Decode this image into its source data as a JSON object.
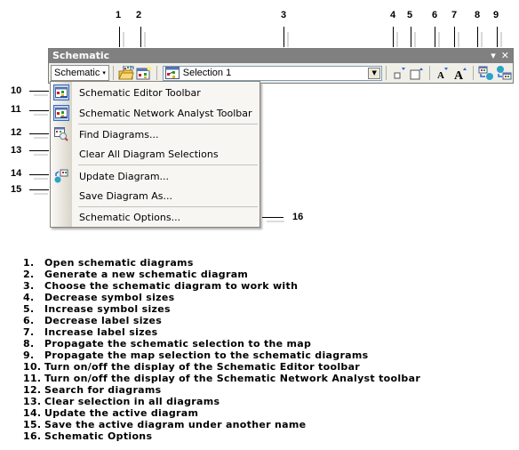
{
  "window": {
    "title": "Schematic",
    "title_buttons": {
      "dropdown": "▾",
      "close": "✕"
    }
  },
  "toolbar": {
    "menu_button_label": "Schematic",
    "menu_button_caret": "▾",
    "buttons": [
      {
        "id": 1,
        "name": "open-schematic-diagrams",
        "icon": "open-folder-diagram-icon"
      },
      {
        "id": 2,
        "name": "generate-new-schematic-diagram",
        "icon": "new-diagram-icon"
      },
      {
        "id": 4,
        "name": "decrease-symbol-sizes",
        "icon": "decrease-symbol-icon"
      },
      {
        "id": 5,
        "name": "increase-symbol-sizes",
        "icon": "increase-symbol-icon"
      },
      {
        "id": 6,
        "name": "decrease-label-sizes",
        "icon": "decrease-label-icon"
      },
      {
        "id": 7,
        "name": "increase-label-sizes",
        "icon": "increase-label-icon"
      },
      {
        "id": 8,
        "name": "propagate-schematic-to-map",
        "icon": "diagram-to-globe-icon"
      },
      {
        "id": 9,
        "name": "propagate-map-to-schematic",
        "icon": "globe-to-diagram-icon"
      }
    ],
    "diagram_combo": {
      "value": "Selection 1",
      "arrow": "▼"
    }
  },
  "menu": {
    "items": [
      {
        "label": "Schematic Editor Toolbar",
        "icon": "editor-toolbar-icon",
        "checked": true
      },
      {
        "label": "Schematic Network Analyst Toolbar",
        "icon": "network-analyst-toolbar-icon",
        "checked": true
      },
      {
        "label": "Find Diagrams...",
        "icon": "find-diagrams-icon",
        "checked": false
      },
      {
        "label": "Clear All Diagram Selections",
        "icon": "",
        "checked": false
      },
      {
        "label": "Update Diagram...",
        "icon": "update-diagram-icon",
        "checked": false
      },
      {
        "label": "Save Diagram As...",
        "icon": "",
        "checked": false
      },
      {
        "label": "Schematic Options...",
        "icon": "",
        "checked": false
      }
    ]
  },
  "callouts": {
    "top": [
      "1",
      "2",
      "3",
      "4",
      "5",
      "6",
      "7",
      "8",
      "9"
    ],
    "left": [
      "10",
      "11",
      "12",
      "13",
      "14",
      "15"
    ],
    "right": [
      "16"
    ]
  },
  "legend": [
    {
      "num": "1.",
      "text": "Open schematic diagrams"
    },
    {
      "num": "2.",
      "text": "Generate a new schematic diagram"
    },
    {
      "num": "3.",
      "text": "Choose the schematic diagram to work with"
    },
    {
      "num": "4.",
      "text": "Decrease symbol sizes"
    },
    {
      "num": "5.",
      "text": "Increase symbol sizes"
    },
    {
      "num": "6.",
      "text": "Decrease label sizes"
    },
    {
      "num": "7.",
      "text": "Increase label sizes"
    },
    {
      "num": "8.",
      "text": "Propagate the schematic selection to the map"
    },
    {
      "num": "9.",
      "text": "Propagate the map selection to the schematic diagrams"
    },
    {
      "num": "10.",
      "text": "Turn on/off the display of the Schematic Editor toolbar"
    },
    {
      "num": "11.",
      "text": "Turn on/off the display of the Schematic Network Analyst toolbar"
    },
    {
      "num": "12.",
      "text": "Search for diagrams"
    },
    {
      "num": "13.",
      "text": "Clear selection in all diagrams"
    },
    {
      "num": "14.",
      "text": "Update the active diagram"
    },
    {
      "num": "15.",
      "text": "Save the active diagram under another name"
    },
    {
      "num": "16.",
      "text": "Schematic Options"
    }
  ]
}
